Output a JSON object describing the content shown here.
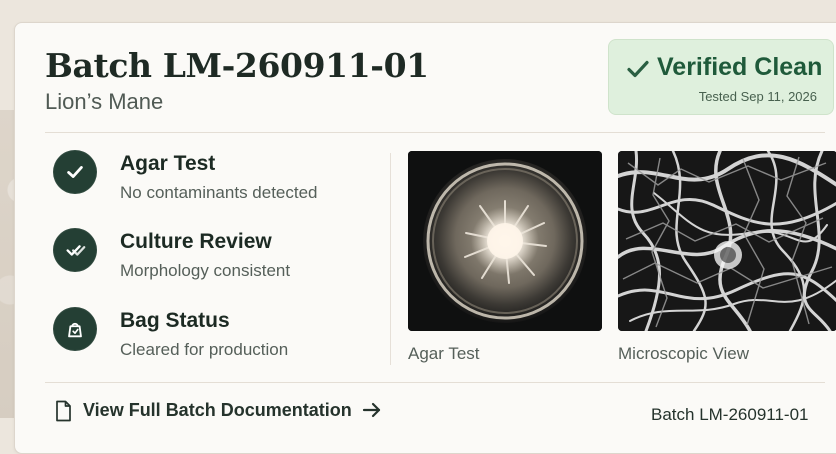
{
  "header": {
    "title": "Batch LM-260911-01",
    "subtitle": "Lion’s Mane"
  },
  "status": {
    "label": "Verified Clean",
    "tested": "Tested Sep 11, 2026",
    "color": "#1f5a3a",
    "background": "#dff0dd"
  },
  "checks": [
    {
      "title": "Agar Test",
      "description": "No contaminants detected",
      "icon": "check-icon"
    },
    {
      "title": "Culture Review",
      "description": "Morphology consistent",
      "icon": "double-check-icon"
    },
    {
      "title": "Bag Status",
      "description": "Cleared for production",
      "icon": "bag-icon"
    }
  ],
  "media": [
    {
      "label": "Agar Test",
      "image": "agar-plate-image"
    },
    {
      "label": "Microscopic View",
      "image": "microscopic-view-image"
    }
  ],
  "footer": {
    "documentation_link": "View Full Batch Documentation",
    "batch_reference": "Batch LM-260911-01",
    "document_icon": "document-icon",
    "arrow_icon": "arrow-right-icon"
  }
}
